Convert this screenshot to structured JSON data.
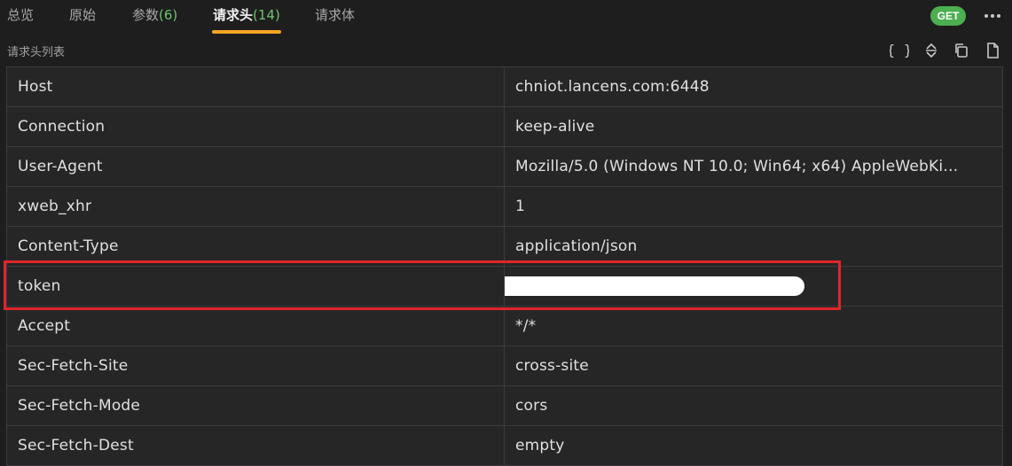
{
  "tabs": [
    {
      "label": "总览",
      "count": ""
    },
    {
      "label": "原始",
      "count": ""
    },
    {
      "label": "参数",
      "count": "(6)"
    },
    {
      "label": "请求头",
      "count": "(14)"
    },
    {
      "label": "请求体",
      "count": ""
    }
  ],
  "active_tab": "请求头",
  "method": "GET",
  "list_title": "请求头列表",
  "toolbar_icons": [
    "braces-icon",
    "expand-collapse-icon",
    "copy-icon",
    "file-icon"
  ],
  "headers": [
    {
      "key": "Host",
      "value": "chniot.lancens.com:6448"
    },
    {
      "key": "Connection",
      "value": "keep-alive"
    },
    {
      "key": "User-Agent",
      "value": "Mozilla/5.0 (Windows NT 10.0; Win64; x64) AppleWebKi…"
    },
    {
      "key": "xweb_xhr",
      "value": "1"
    },
    {
      "key": "Content-Type",
      "value": "application/json"
    },
    {
      "key": "token",
      "value": ""
    },
    {
      "key": "Accept",
      "value": "*/*"
    },
    {
      "key": "Sec-Fetch-Site",
      "value": "cross-site"
    },
    {
      "key": "Sec-Fetch-Mode",
      "value": "cors"
    },
    {
      "key": "Sec-Fetch-Dest",
      "value": "empty"
    }
  ],
  "colors": {
    "accent": "#f5a623",
    "count": "#6cc36c",
    "method_badge": "#4caf50",
    "highlight": "#e1252b"
  }
}
